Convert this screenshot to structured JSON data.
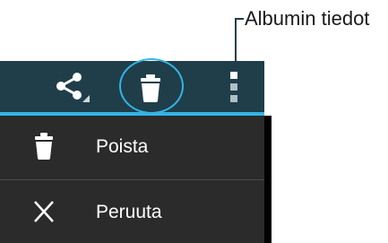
{
  "callout": {
    "label": "Albumin tiedot"
  },
  "action_bar": {
    "share_icon": "share-icon",
    "delete_icon": "trash-icon",
    "overflow_icon": "overflow-menu-icon"
  },
  "menu": {
    "items": [
      {
        "label": "Poista",
        "icon": "trash-icon"
      },
      {
        "label": "Peruuta",
        "icon": "close-icon"
      }
    ]
  },
  "colors": {
    "action_bar": "#1f3e4a",
    "accent": "#33b5e5",
    "menu_bg": "#2b2b2b",
    "text": "#ffffff"
  }
}
